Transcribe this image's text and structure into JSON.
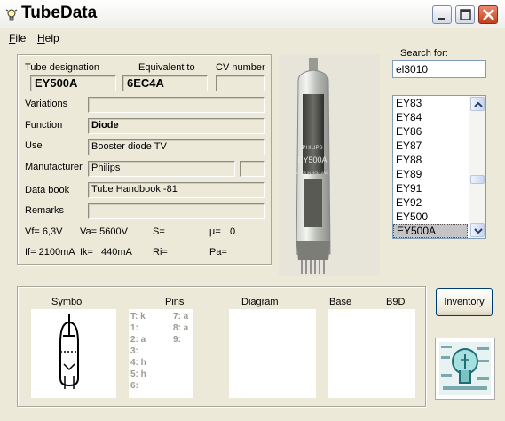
{
  "window": {
    "title": "TubeData"
  },
  "menu": [
    {
      "label": "File"
    },
    {
      "label": "Help"
    }
  ],
  "details": {
    "tube_designation_label": "Tube designation",
    "tube_designation": "EY500A",
    "equivalent_label": "Equivalent to",
    "equivalent": "6EC4A",
    "cv_label": "CV number",
    "cv": "",
    "variations_label": "Variations",
    "variations": "",
    "function_label": "Function",
    "function": "Diode",
    "use_label": "Use",
    "use": "Booster diode TV",
    "manufacturer_label": "Manufacturer",
    "manufacturer": "Philips",
    "manufacturer_extra": "",
    "databook_label": "Data book",
    "databook": "Tube Handbook -81",
    "remarks_label": "Remarks",
    "remarks": ""
  },
  "params": {
    "vf": "Vf= 6,3V",
    "va": "Va= 5600V",
    "s": "S=",
    "mu": "µ=",
    "mu_value": "0",
    "if": "If= 2100mA",
    "ik": "Ik=",
    "ik_value": "440mA",
    "ri": "Ri=",
    "pa": "Pa="
  },
  "photo": {
    "print_lines": [
      "PHILIPS",
      "EY500A",
      "MADE IN HOLLAND"
    ]
  },
  "search": {
    "label": "Search for:",
    "value": "el3010",
    "results": [
      "EY83",
      "EY84",
      "EY86",
      "EY87",
      "EY88",
      "EY89",
      "EY91",
      "EY92",
      "EY500",
      "EY500A"
    ],
    "selected_index": 9,
    "thumb_fraction": 0.62
  },
  "bottom": {
    "symbol_label": "Symbol",
    "pins_label": "Pins",
    "diagram_label": "Diagram",
    "base_label": "Base",
    "base_value": "B9D",
    "pins_left": [
      "T: k",
      "1:",
      "2: a",
      "3:",
      "4: h",
      "5: h",
      "6:"
    ],
    "pins_right": [
      "7: a",
      "8: a",
      "9:"
    ]
  },
  "inventory_button": "Inventory",
  "colors": {
    "selection": "#c4c4c4",
    "pin_text": "#9a9a8e",
    "close_button": "#c4401c"
  }
}
